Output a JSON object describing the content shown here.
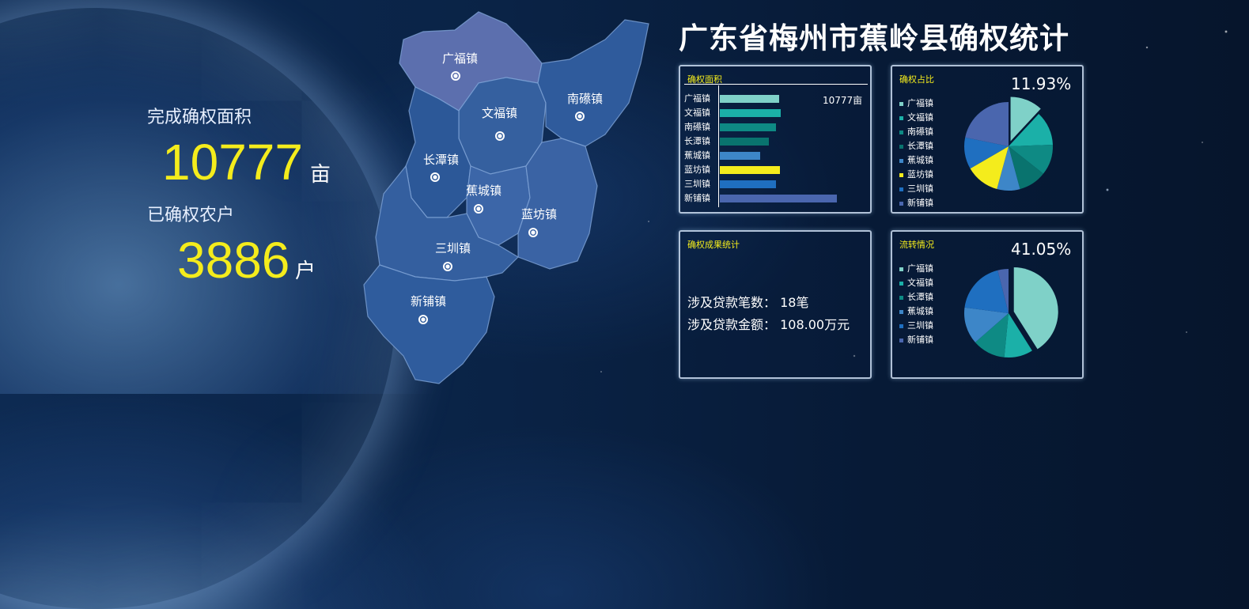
{
  "title": "广东省梅州市蕉岭县确权统计",
  "kpis": {
    "area_label": "完成确权面积",
    "area_value": "10777",
    "area_unit": "亩",
    "households_label": "已确权农户",
    "households_value": "3886",
    "households_unit": "户"
  },
  "map": {
    "towns": [
      "广福镇",
      "南礤镇",
      "文福镇",
      "长潭镇",
      "蕉城镇",
      "蓝坊镇",
      "三圳镇",
      "新铺镇"
    ]
  },
  "colors": {
    "accent_yellow": "#f4ec1c",
    "teal_light": "#7fd1c8",
    "teal": "#1bb0a8",
    "teal_dark": "#0e8a84",
    "teal_deep": "#09736e",
    "blue_mid": "#3d86c8",
    "blue": "#1f6fc0",
    "blue_slate": "#4a66ae"
  },
  "area_panel": {
    "title": "确权面积",
    "annotation": "10777亩",
    "chart_data": {
      "type": "bar",
      "orientation": "horizontal",
      "categories": [
        "广福镇",
        "文福镇",
        "南礤镇",
        "长潭镇",
        "蕉城镇",
        "蓝坊镇",
        "三圳镇",
        "新铺镇"
      ],
      "values": [
        1320,
        1350,
        1250,
        1100,
        900,
        1340,
        1250,
        2620
      ],
      "colors": [
        "#7fd1c8",
        "#1bb0a8",
        "#0e8a84",
        "#09736e",
        "#3d86c8",
        "#f4ec1c",
        "#1f6fc0",
        "#4a66ae"
      ],
      "xlim": [
        0,
        3000
      ]
    }
  },
  "ratio_panel": {
    "title": "确权占比",
    "percent": "11.93%",
    "legend": [
      "广福镇",
      "文福镇",
      "南礤镇",
      "长潭镇",
      "蕉城镇",
      "蓝坊镇",
      "三圳镇",
      "新铺镇"
    ],
    "chart_data": {
      "type": "pie",
      "labels": [
        "广福镇",
        "文福镇",
        "南礤镇",
        "长潭镇",
        "蕉城镇",
        "蓝坊镇",
        "三圳镇",
        "新铺镇"
      ],
      "values": [
        11.93,
        12.5,
        11.2,
        10.2,
        8.4,
        12.4,
        11.6,
        21.77
      ],
      "colors": [
        "#7fd1c8",
        "#1bb0a8",
        "#0e8a84",
        "#09736e",
        "#3d86c8",
        "#f4ec1c",
        "#1f6fc0",
        "#4a66ae"
      ],
      "highlight": 0
    }
  },
  "result_panel": {
    "title": "确权成果统计",
    "loan_count": "涉及贷款笔数： 18笔",
    "loan_amount": "涉及贷款金额： 108.00万元"
  },
  "transfer_panel": {
    "title": "流转情况",
    "percent": "41.05%",
    "legend": [
      "广福镇",
      "文福镇",
      "长潭镇",
      "蕉城镇",
      "三圳镇",
      "新铺镇"
    ],
    "chart_data": {
      "type": "pie",
      "labels": [
        "广福镇",
        "文福镇",
        "长潭镇",
        "蕉城镇",
        "三圳镇",
        "新铺镇"
      ],
      "values": [
        41.05,
        10.5,
        12.0,
        13.5,
        19.0,
        3.95
      ],
      "colors": [
        "#7fd1c8",
        "#1bb0a8",
        "#0e8a84",
        "#3d86c8",
        "#1f6fc0",
        "#4a66ae"
      ],
      "highlight": 0
    }
  }
}
